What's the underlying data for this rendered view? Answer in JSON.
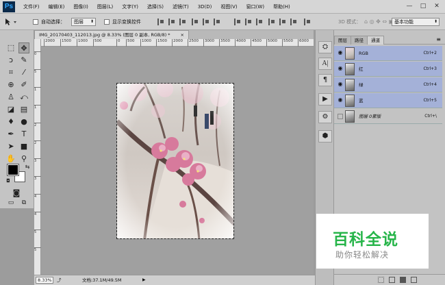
{
  "app": {
    "logo": "Ps"
  },
  "menu": [
    "文件(F)",
    "编辑(E)",
    "图像(I)",
    "图层(L)",
    "文字(Y)",
    "选择(S)",
    "滤镜(T)",
    "3D(D)",
    "视图(V)",
    "窗口(W)",
    "帮助(H)"
  ],
  "window_controls": [
    "—",
    "□",
    "✕"
  ],
  "options_bar": {
    "auto_select_label": "自动选择：",
    "auto_select_target": "图层",
    "show_transform_label": "显示变换控件",
    "mode_label": "3D 模式：",
    "workspace": "基本功能"
  },
  "document": {
    "tab_title": "IMG_20170403_112013.jpg @ 8.33% (图层 0 副本, RGB/8) *",
    "close_glyph": "×",
    "zoom": "8.33%",
    "doc_info": "文档:37.1M/49.5M"
  },
  "rulers": {
    "h_ticks": [
      "2000",
      "1500",
      "1000",
      "500",
      "0",
      "500",
      "1000",
      "1500",
      "2000",
      "2500",
      "3000",
      "3500",
      "4000",
      "4500",
      "5000",
      "5500",
      "6000"
    ],
    "v_ticks": [
      "0",
      "5",
      "1",
      "1",
      "2",
      "2",
      "3",
      "3",
      "4",
      "4",
      "5",
      "5"
    ]
  },
  "panel": {
    "tabs": [
      "图层",
      "路径",
      "通道"
    ],
    "active_tab": "通道",
    "channels": [
      {
        "name": "RGB",
        "shortcut": "Ctrl+2",
        "visible": true,
        "selected": true
      },
      {
        "name": "红",
        "shortcut": "Ctrl+3",
        "visible": true,
        "selected": true
      },
      {
        "name": "绿",
        "shortcut": "Ctrl+4",
        "visible": true,
        "selected": true
      },
      {
        "name": "蓝",
        "shortcut": "Ctrl+5",
        "visible": true,
        "selected": true
      },
      {
        "name": "图层 0蒙版",
        "shortcut": "Ctrl+\\",
        "visible": false,
        "selected": false
      }
    ]
  },
  "watermark": {
    "title": "百科全说",
    "subtitle": "助你轻松解决"
  },
  "colors": {
    "selection": "#a4b1d8",
    "watermark_green": "#27b54a"
  }
}
